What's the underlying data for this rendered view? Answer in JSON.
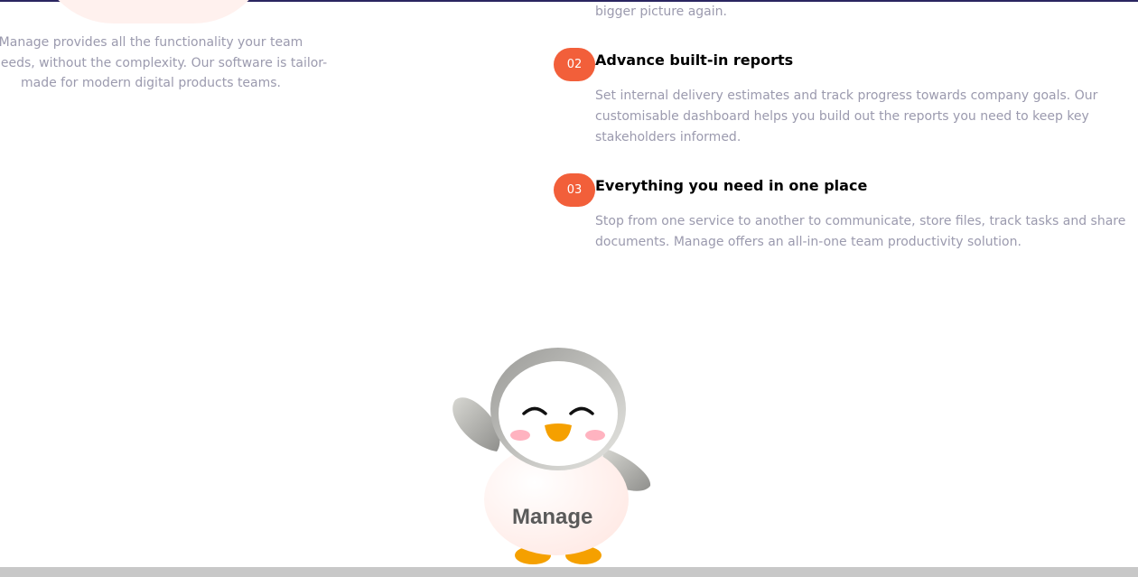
{
  "intro": {
    "lines": [
      "Manage provides all the functionality your team",
      "needs, without the complexity. Our software is tailor-",
      "made for modern digital products teams."
    ]
  },
  "partial_previous_text": "bigger picture again.",
  "features": [
    {
      "number": "02",
      "title": "Advance built-in reports",
      "desc_lines": [
        "Set internal delivery estimates and track progress towards company goals. Our",
        "customisable dashboard helps you build out the reports you need to keep key",
        "stakeholders informed."
      ]
    },
    {
      "number": "03",
      "title": "Everything you need in one place",
      "desc_lines": [
        "Stop from one service to another to communicate, store files, track tasks and share",
        "documents. Manage offers an all-in-one team productivity solution."
      ]
    }
  ],
  "mascot": {
    "label": "Manage",
    "icon": "penguin-mascot-icon"
  },
  "colors": {
    "accent": "#f25f3a",
    "muted_text": "#9b9aae",
    "heading": "#000000",
    "top_border": "#2a2560"
  }
}
